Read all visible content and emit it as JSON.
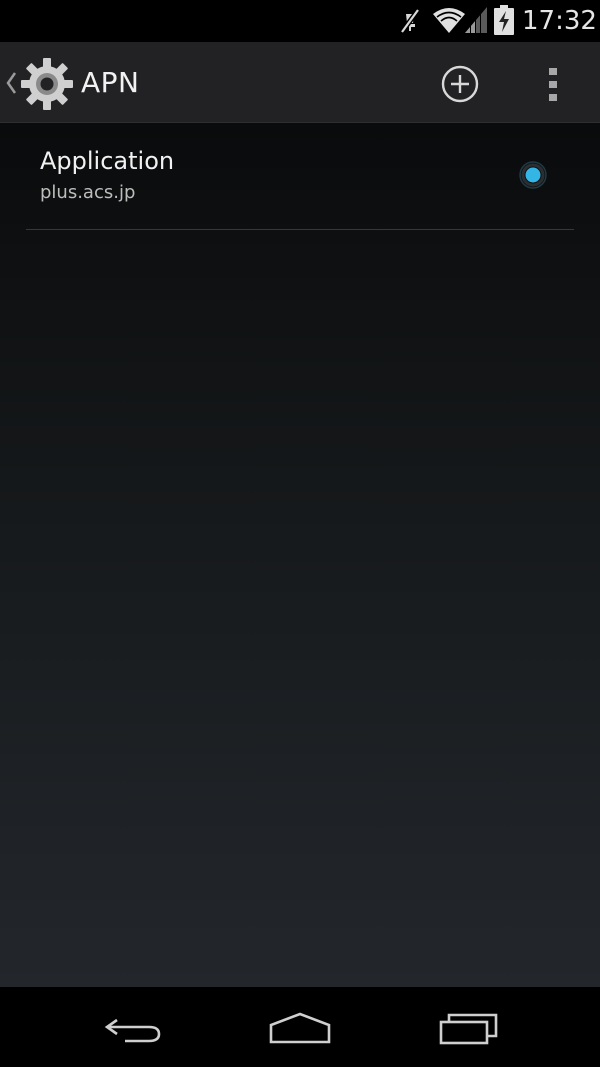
{
  "status_bar": {
    "time": "17:32",
    "icons": [
      "mute-icon",
      "wifi-icon",
      "signal-icon",
      "battery-charging-icon"
    ]
  },
  "action_bar": {
    "title": "APN",
    "icons": [
      "up-caret-icon",
      "settings-gear-icon",
      "add-icon",
      "overflow-menu-icon"
    ]
  },
  "apn_list": {
    "items": [
      {
        "name": "Application",
        "apn": "plus.acs.jp",
        "selected": true
      }
    ]
  },
  "nav_bar": {
    "icons": [
      "back-icon",
      "home-icon",
      "recents-icon"
    ]
  },
  "colors": {
    "accent": "#33b5e5",
    "action_bar_bg": "#222224",
    "text_primary": "#f1f1f1",
    "text_secondary": "#bdbdbd"
  }
}
